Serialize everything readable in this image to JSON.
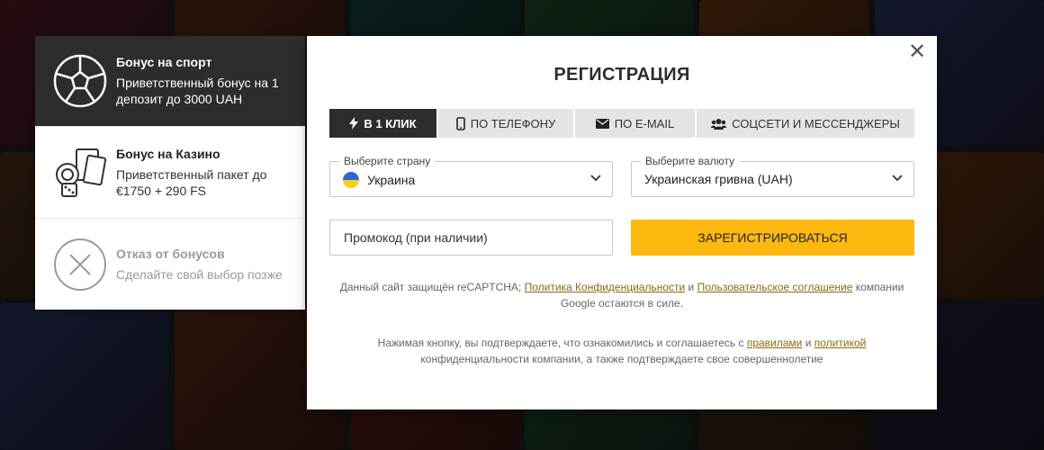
{
  "bonuses": [
    {
      "title": "Бонус на спорт",
      "desc": "Приветственный бонус на 1 депозит до 3000 UAH",
      "icon": "soccer-ball-icon"
    },
    {
      "title": "Бонус на Казино",
      "desc": "Приветственный пакет до €1750 + 290 FS",
      "icon": "casino-cards-dice-icon"
    },
    {
      "title": "Отказ от бонусов",
      "desc": "Сделайте свой выбор позже",
      "icon": "cancel-circle-icon"
    }
  ],
  "modal": {
    "title": "РЕГИСТРАЦИЯ",
    "close": "✕",
    "tabs": [
      {
        "label": "В 1 КЛИК",
        "icon": "lightning-icon"
      },
      {
        "label": "ПО ТЕЛЕФОНУ",
        "icon": "phone-icon"
      },
      {
        "label": "ПО E-MAIL",
        "icon": "envelope-icon"
      },
      {
        "label": "СОЦСЕТИ И МЕССЕНДЖЕРЫ",
        "icon": "users-icon"
      }
    ],
    "country": {
      "label": "Выберите страну",
      "value": "Украина"
    },
    "currency": {
      "label": "Выберите валюту",
      "value": "Украинская гривна (UAH)"
    },
    "promo_placeholder": "Промокод (при наличии)",
    "register_label": "ЗАРЕГИСТРИРОВАТЬСЯ",
    "legal1": {
      "pre": "Данный сайт защищён reCAPTCHA; ",
      "link1": "Политика Конфиденциальности",
      "mid": " и ",
      "link2": "Пользовательское соглашение",
      "post": " компании Google остаются в силе."
    },
    "legal2": {
      "pre": "Нажимая кнопку, вы подтверждаете, что ознакомились и соглашаетесь с ",
      "link1": "правилами",
      "mid": " и ",
      "link2": "политикой",
      "post": " конфиденциальности компании, а также подтверждаете свое совершеннолетие"
    }
  },
  "colors": {
    "accent": "#fdb810",
    "dark": "#2d2d2d",
    "link": "#8a6a10"
  }
}
